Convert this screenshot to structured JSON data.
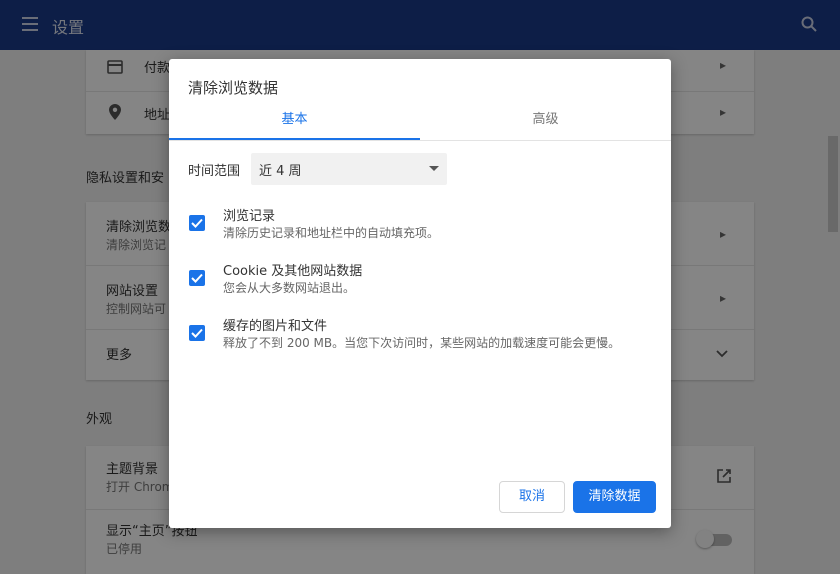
{
  "header": {
    "title": "设置",
    "menu_icon": "hamburger-icon",
    "search_icon": "search-icon"
  },
  "background": {
    "autofill_rows": [
      {
        "label": "付款",
        "icon": "card-icon"
      },
      {
        "label": "地址",
        "icon": "location-pin-icon"
      }
    ],
    "privacy_section_title": "隐私设置和安",
    "privacy_rows": [
      {
        "title": "清除浏览数",
        "subtitle": "清除浏览记"
      },
      {
        "title": "网站设置",
        "subtitle": "控制网站可"
      },
      {
        "title": "更多",
        "subtitle": ""
      }
    ],
    "appearance_section_title": "外观",
    "appearance_rows": [
      {
        "title": "主题背景",
        "subtitle": "打开 Chrom"
      },
      {
        "title": "显示“主页”按钮",
        "subtitle": "已停用"
      }
    ]
  },
  "dialog": {
    "title": "清除浏览数据",
    "tabs": [
      {
        "label": "基本",
        "active": true
      },
      {
        "label": "高级",
        "active": false
      }
    ],
    "time_range": {
      "label": "时间范围",
      "selected": "近 4 周"
    },
    "options": [
      {
        "title": "浏览记录",
        "description": "清除历史记录和地址栏中的自动填充项。",
        "checked": true
      },
      {
        "title": "Cookie 及其他网站数据",
        "description": "您会从大多数网站退出。",
        "checked": true
      },
      {
        "title": "缓存的图片和文件",
        "description": "释放了不到 200 MB。当您下次访问时，某些网站的加载速度可能会更慢。",
        "checked": true
      }
    ],
    "buttons": {
      "cancel": "取消",
      "clear": "清除数据"
    }
  },
  "colors": {
    "header_bg": "#1a3a88",
    "accent": "#1a73e8"
  }
}
